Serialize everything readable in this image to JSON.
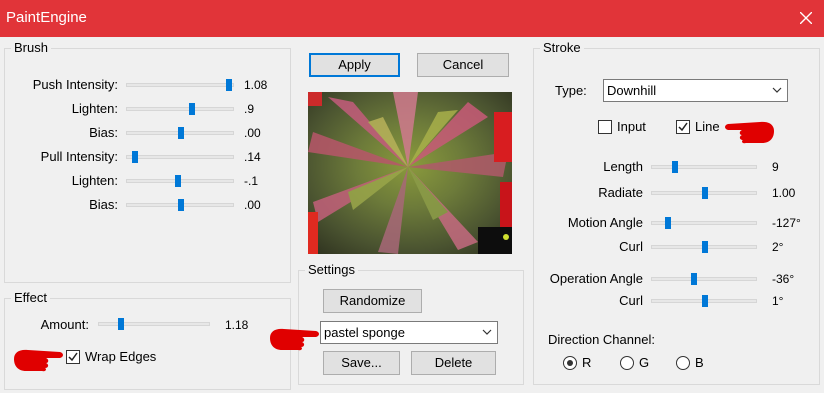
{
  "window": {
    "title": "PaintEngine"
  },
  "brush": {
    "title": "Brush",
    "rows": [
      {
        "label": "Push Intensity:",
        "value": "1.08",
        "level": 0.94
      },
      {
        "label": "Lighten:",
        "value": ".9",
        "level": 0.6
      },
      {
        "label": "Bias:",
        "value": ".00",
        "level": 0.5
      },
      {
        "label": "Pull Intensity:",
        "value": ".14",
        "level": 0.07
      },
      {
        "label": "Lighten:",
        "value": "-.1",
        "level": 0.47
      },
      {
        "label": "Bias:",
        "value": ".00",
        "level": 0.5
      }
    ]
  },
  "effect": {
    "title": "Effect",
    "amount_label": "Amount:",
    "amount_value": "1.18",
    "amount_level": 0.2,
    "wrap_edges_label": "Wrap Edges",
    "wrap_edges_checked": true
  },
  "buttons": {
    "apply": "Apply",
    "cancel": "Cancel"
  },
  "settings": {
    "title": "Settings",
    "randomize": "Randomize",
    "preset": "pastel sponge",
    "save": "Save...",
    "delete": "Delete"
  },
  "stroke": {
    "title": "Stroke",
    "type_label": "Type:",
    "type_value": "Downhill",
    "input_label": "Input",
    "input_checked": false,
    "line_label": "Line",
    "line_checked": true,
    "rows": [
      {
        "label": "Length",
        "value": "9",
        "level": 0.22
      },
      {
        "label": "Radiate",
        "value": "1.00",
        "level": 0.5
      },
      {
        "label": "Motion Angle",
        "value": "-127°",
        "level": 0.15
      },
      {
        "label": "Curl",
        "value": "2°",
        "level": 0.5
      },
      {
        "label": "Operation Angle",
        "value": "-36°",
        "level": 0.4
      },
      {
        "label": "Curl",
        "value": "1°",
        "level": 0.5
      }
    ],
    "direction_label": "Direction Channel:",
    "channels": [
      {
        "label": "R",
        "selected": true
      },
      {
        "label": "G",
        "selected": false
      },
      {
        "label": "B",
        "selected": false
      }
    ]
  },
  "icons": {
    "close": "close-icon",
    "pointer": "pointing-hand-icon",
    "chevron": "chevron-down-icon",
    "check": "checkmark-icon"
  },
  "colors": {
    "titlebar": "#e13439",
    "accent": "#0078d7",
    "pointer": "#e00000"
  }
}
